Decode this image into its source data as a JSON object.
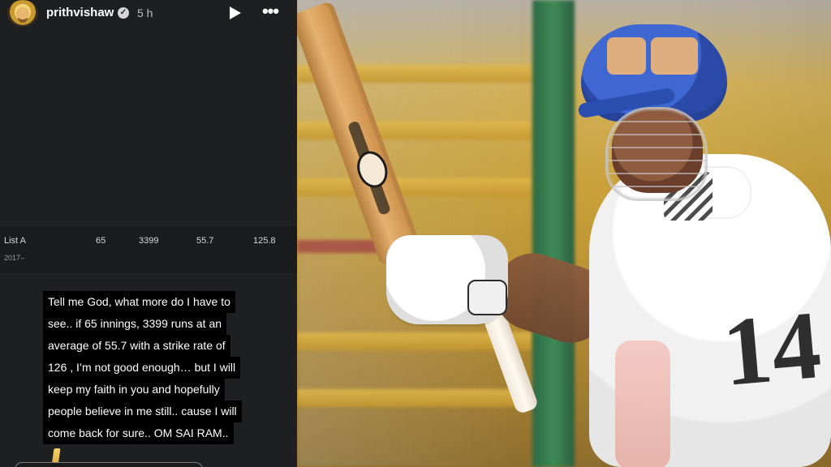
{
  "story": {
    "username": "prithvishaw",
    "time": "5 h",
    "icons": {
      "avatar": "avatar",
      "verified": "verified-badge-icon",
      "play": "play-icon",
      "more": "more-options-icon"
    },
    "stats": {
      "label": "List A",
      "years": "2017–",
      "innings": "65",
      "runs": "3399",
      "average": "55.7",
      "strike_rate": "125.8"
    },
    "caption_lines": [
      "Tell me God, what more do I have to",
      "see.. if 65 innings, 3399 runs at an",
      "average of 55.7 with a strike rate of",
      "126 , I’m not good enough… but I will",
      "keep my faith in you and hopefully",
      "people believe in me still.. cause I will",
      "come back for sure.. OM SAI RAM.."
    ]
  },
  "photo": {
    "jersey_number": "14"
  }
}
